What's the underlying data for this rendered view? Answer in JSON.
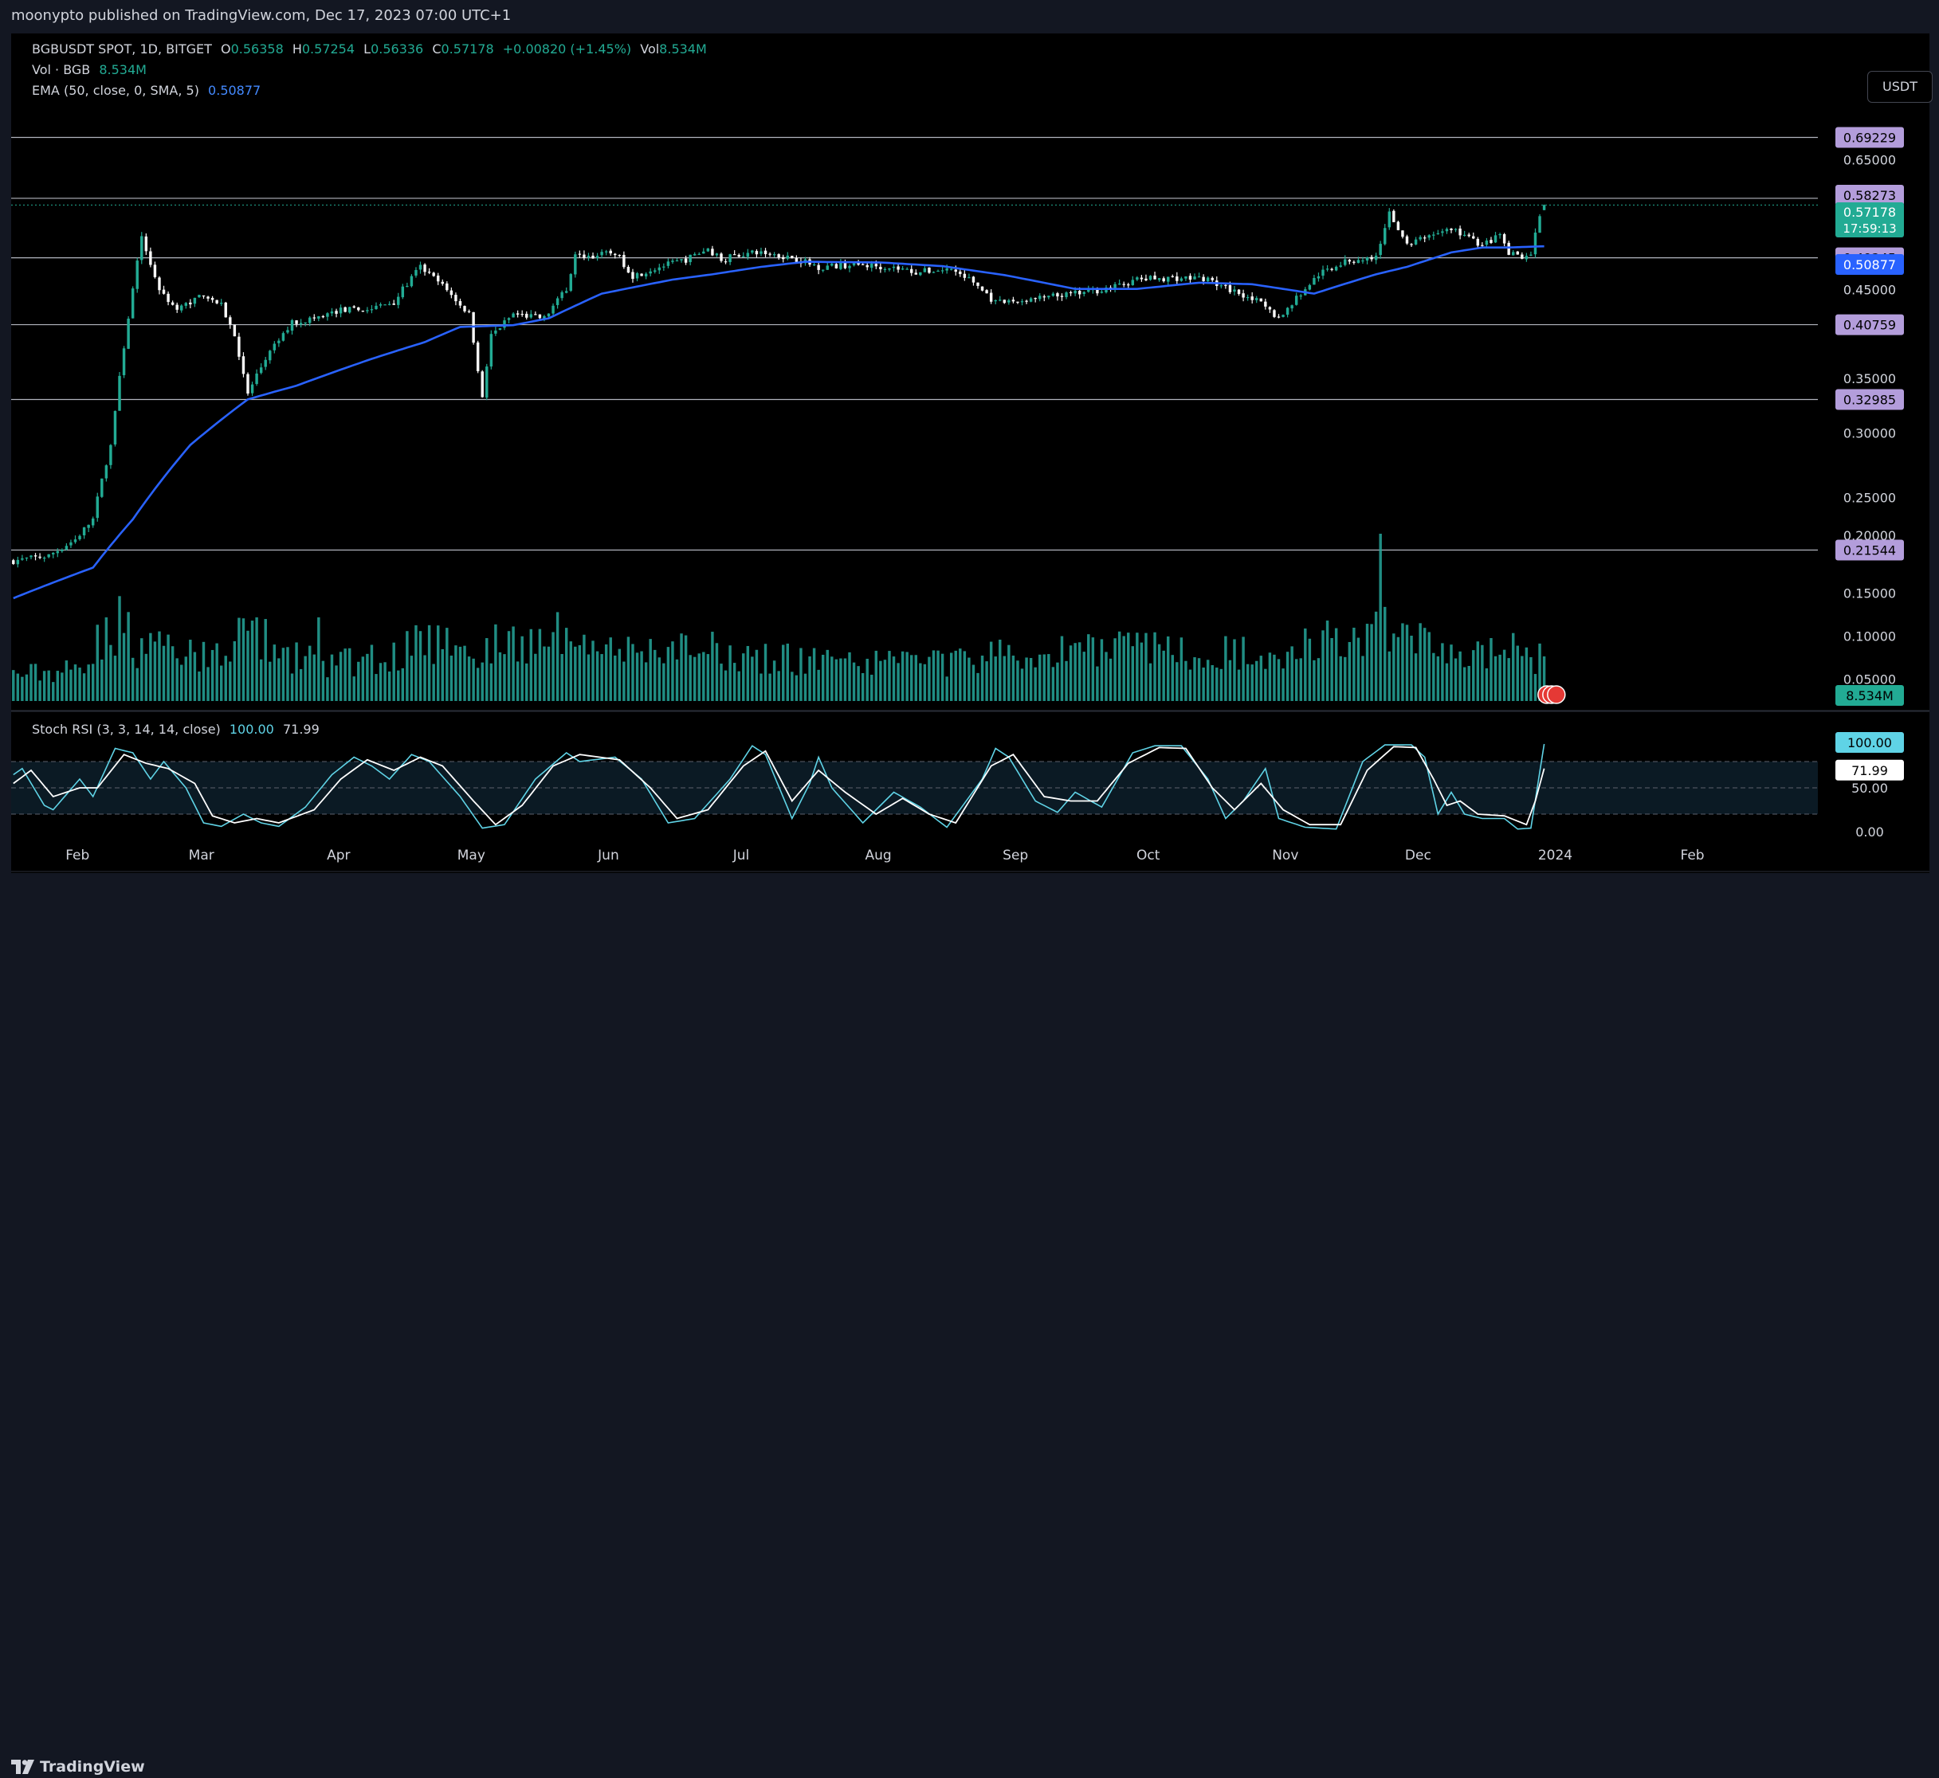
{
  "publish_line": "moonypto published on TradingView.com, Dec 17, 2023 07:00 UTC+1",
  "brand": "TradingView",
  "currency_button": "USDT",
  "legend": {
    "symbol": "BGBUSDT SPOT, 1D, BITGET",
    "open_label": "O",
    "open": "0.56358",
    "high_label": "H",
    "high": "0.57254",
    "low_label": "L",
    "low": "0.56336",
    "close_label": "C",
    "close": "0.57178",
    "change": "+0.00820 (+1.45%)",
    "vol_label": "Vol",
    "vol": "8.534M",
    "vol_row_label": "Vol · BGB",
    "vol_row_value": "8.534M",
    "ema_label": "EMA (50, close, 0, SMA, 5)",
    "ema_value": "0.50877",
    "stoch_label": "Stoch RSI (3, 3, 14, 14, close)",
    "stoch_k": "100.00",
    "stoch_d": "71.99"
  },
  "colors": {
    "up": "#22ab94",
    "down": "#f7f7f7",
    "ema": "#2962ff",
    "level": "#b2b5be",
    "level_badge": "#b39ddb",
    "stoch_k": "#5fd3e6",
    "stoch_d": "#ffffff",
    "volume": "#26a69a"
  },
  "chart_data": {
    "type": "candlestick",
    "x_range": [
      "2023-01-17",
      "2024-02-29"
    ],
    "x_ticks": [
      {
        "label": "Feb",
        "date": "2023-02-01"
      },
      {
        "label": "Mar",
        "date": "2023-03-01"
      },
      {
        "label": "Apr",
        "date": "2023-04-01"
      },
      {
        "label": "May",
        "date": "2023-05-01"
      },
      {
        "label": "Jun",
        "date": "2023-06-01"
      },
      {
        "label": "Jul",
        "date": "2023-07-01"
      },
      {
        "label": "Aug",
        "date": "2023-08-01"
      },
      {
        "label": "Sep",
        "date": "2023-09-01"
      },
      {
        "label": "Oct",
        "date": "2023-10-01"
      },
      {
        "label": "Nov",
        "date": "2023-11-01"
      },
      {
        "label": "Dec",
        "date": "2023-12-01"
      },
      {
        "label": "2024",
        "date": "2024-01-01"
      },
      {
        "label": "Feb",
        "date": "2024-02-01"
      }
    ],
    "y_ticks": [
      "0.65000",
      "0.45000",
      "0.35000",
      "0.30000",
      "0.25000",
      "0.20000",
      "0.15000",
      "0.10000",
      "0.05000"
    ],
    "y_range": [
      0.028,
      0.7
    ],
    "horizontal_levels": [
      "0.69229",
      "0.58273",
      "0.49245",
      "0.40759",
      "0.32985",
      "0.21544"
    ],
    "last_price": "0.57178",
    "countdown": "17:59:13",
    "ema_last": "0.50877",
    "volume_last": "8.534M",
    "price_anchors": [
      [
        "2023-01-17",
        0.209
      ],
      [
        "2023-01-25",
        0.212
      ],
      [
        "2023-01-31",
        0.222
      ],
      [
        "2023-02-04",
        0.235
      ],
      [
        "2023-02-08",
        0.29
      ],
      [
        "2023-02-10",
        0.35
      ],
      [
        "2023-02-13",
        0.45
      ],
      [
        "2023-02-15",
        0.52
      ],
      [
        "2023-02-19",
        0.45
      ],
      [
        "2023-02-23",
        0.425
      ],
      [
        "2023-03-01",
        0.445
      ],
      [
        "2023-03-05",
        0.43
      ],
      [
        "2023-03-08",
        0.395
      ],
      [
        "2023-03-11",
        0.335
      ],
      [
        "2023-03-15",
        0.37
      ],
      [
        "2023-03-21",
        0.41
      ],
      [
        "2023-03-26",
        0.415
      ],
      [
        "2023-04-01",
        0.425
      ],
      [
        "2023-04-07",
        0.425
      ],
      [
        "2023-04-13",
        0.435
      ],
      [
        "2023-04-19",
        0.48
      ],
      [
        "2023-04-24",
        0.455
      ],
      [
        "2023-04-30",
        0.42
      ],
      [
        "2023-05-03",
        0.33
      ],
      [
        "2023-05-05",
        0.395
      ],
      [
        "2023-05-10",
        0.42
      ],
      [
        "2023-05-17",
        0.415
      ],
      [
        "2023-05-22",
        0.45
      ],
      [
        "2023-05-24",
        0.495
      ],
      [
        "2023-05-28",
        0.495
      ],
      [
        "2023-06-02",
        0.5
      ],
      [
        "2023-06-06",
        0.468
      ],
      [
        "2023-06-12",
        0.48
      ],
      [
        "2023-06-18",
        0.49
      ],
      [
        "2023-06-23",
        0.505
      ],
      [
        "2023-06-26",
        0.49
      ],
      [
        "2023-06-30",
        0.497
      ],
      [
        "2023-07-05",
        0.5
      ],
      [
        "2023-07-12",
        0.493
      ],
      [
        "2023-07-18",
        0.48
      ],
      [
        "2023-07-26",
        0.483
      ],
      [
        "2023-08-03",
        0.48
      ],
      [
        "2023-08-09",
        0.473
      ],
      [
        "2023-08-17",
        0.477
      ],
      [
        "2023-08-22",
        0.46
      ],
      [
        "2023-08-27",
        0.433
      ],
      [
        "2023-09-03",
        0.437
      ],
      [
        "2023-09-10",
        0.442
      ],
      [
        "2023-09-17",
        0.447
      ],
      [
        "2023-09-24",
        0.455
      ],
      [
        "2023-09-28",
        0.463
      ],
      [
        "2023-10-03",
        0.465
      ],
      [
        "2023-10-08",
        0.465
      ],
      [
        "2023-10-13",
        0.465
      ],
      [
        "2023-10-18",
        0.452
      ],
      [
        "2023-10-24",
        0.44
      ],
      [
        "2023-10-30",
        0.415
      ],
      [
        "2023-11-04",
        0.445
      ],
      [
        "2023-11-08",
        0.47
      ],
      [
        "2023-11-13",
        0.485
      ],
      [
        "2023-11-17",
        0.49
      ],
      [
        "2023-11-21",
        0.493
      ],
      [
        "2023-11-24",
        0.56
      ],
      [
        "2023-11-28",
        0.51
      ],
      [
        "2023-12-03",
        0.525
      ],
      [
        "2023-12-08",
        0.535
      ],
      [
        "2023-12-15",
        0.51
      ],
      [
        "2023-12-19",
        0.525
      ],
      [
        "2023-12-21",
        0.497
      ],
      [
        "2023-12-25",
        0.495
      ],
      [
        "2023-12-26",
        0.5
      ],
      [
        "2023-12-28",
        0.553
      ],
      [
        "2023-12-29",
        0.5718
      ]
    ],
    "ema_anchors": [
      [
        "2023-01-17",
        0.188
      ],
      [
        "2023-02-04",
        0.205
      ],
      [
        "2023-02-13",
        0.235
      ],
      [
        "2023-02-26",
        0.29
      ],
      [
        "2023-03-11",
        0.33
      ],
      [
        "2023-03-22",
        0.343
      ],
      [
        "2023-04-08",
        0.37
      ],
      [
        "2023-04-20",
        0.388
      ],
      [
        "2023-04-28",
        0.405
      ],
      [
        "2023-05-10",
        0.407
      ],
      [
        "2023-05-18",
        0.415
      ],
      [
        "2023-05-30",
        0.445
      ],
      [
        "2023-06-15",
        0.463
      ],
      [
        "2023-06-24",
        0.47
      ],
      [
        "2023-07-05",
        0.48
      ],
      [
        "2023-07-15",
        0.487
      ],
      [
        "2023-08-01",
        0.486
      ],
      [
        "2023-08-15",
        0.481
      ],
      [
        "2023-08-29",
        0.469
      ],
      [
        "2023-09-14",
        0.451
      ],
      [
        "2023-09-28",
        0.451
      ],
      [
        "2023-10-12",
        0.459
      ],
      [
        "2023-10-24",
        0.457
      ],
      [
        "2023-11-07",
        0.445
      ],
      [
        "2023-11-21",
        0.47
      ],
      [
        "2023-11-28",
        0.48
      ],
      [
        "2023-12-08",
        0.5
      ],
      [
        "2023-12-15",
        0.507
      ],
      [
        "2023-12-21",
        0.507
      ],
      [
        "2023-12-29",
        0.5088
      ]
    ],
    "volume_max_M": 32,
    "volume_anchors": [
      [
        "2023-01-17",
        5
      ],
      [
        "2023-01-31",
        6
      ],
      [
        "2023-02-06",
        12
      ],
      [
        "2023-02-11",
        16
      ],
      [
        "2023-02-14",
        10
      ],
      [
        "2023-02-25",
        9
      ],
      [
        "2023-03-03",
        8
      ],
      [
        "2023-03-10",
        14
      ],
      [
        "2023-03-20",
        9
      ],
      [
        "2023-03-28",
        7
      ],
      [
        "2023-04-10",
        8
      ],
      [
        "2023-04-20",
        12
      ],
      [
        "2023-05-01",
        9
      ],
      [
        "2023-05-10",
        12
      ],
      [
        "2023-05-18",
        11
      ],
      [
        "2023-05-24",
        17
      ],
      [
        "2023-06-02",
        10
      ],
      [
        "2023-06-12",
        9
      ],
      [
        "2023-06-20",
        10
      ],
      [
        "2023-07-01",
        9
      ],
      [
        "2023-07-15",
        8
      ],
      [
        "2023-08-01",
        7
      ],
      [
        "2023-08-20",
        8
      ],
      [
        "2023-09-05",
        9
      ],
      [
        "2023-09-20",
        11
      ],
      [
        "2023-10-05",
        10
      ],
      [
        "2023-10-20",
        9
      ],
      [
        "2023-11-01",
        10
      ],
      [
        "2023-11-10",
        12
      ],
      [
        "2023-11-18",
        11
      ],
      [
        "2023-11-23",
        15
      ],
      [
        "2023-11-26",
        12
      ],
      [
        "2023-12-05",
        10
      ],
      [
        "2023-12-15",
        9
      ],
      [
        "2023-12-25",
        8
      ],
      [
        "2023-12-29",
        8.534
      ]
    ],
    "volume_spikes": [
      [
        "2023-02-07",
        16
      ],
      [
        "2023-02-17",
        13
      ],
      [
        "2023-03-13",
        16
      ],
      [
        "2023-03-27",
        16
      ],
      [
        "2023-04-25",
        14
      ],
      [
        "2023-05-20",
        17
      ],
      [
        "2023-05-22",
        14
      ],
      [
        "2023-11-22",
        32
      ],
      [
        "2023-11-23",
        18
      ],
      [
        "2023-12-22",
        13
      ]
    ],
    "stoch_rsi": {
      "bands": [
        "80",
        "50",
        "20"
      ],
      "y_ticks": [
        "50.00",
        "0.00"
      ],
      "k_last": "100.00",
      "d_last": "71.99",
      "k_anchors": [
        [
          "2023-01-17",
          65
        ],
        [
          "2023-01-19",
          72
        ],
        [
          "2023-01-24",
          30
        ],
        [
          "2023-01-26",
          25
        ],
        [
          "2023-02-01",
          60
        ],
        [
          "2023-02-04",
          40
        ],
        [
          "2023-02-09",
          95
        ],
        [
          "2023-02-13",
          90
        ],
        [
          "2023-02-17",
          60
        ],
        [
          "2023-02-20",
          80
        ],
        [
          "2023-02-25",
          50
        ],
        [
          "2023-03-01",
          10
        ],
        [
          "2023-03-05",
          6
        ],
        [
          "2023-03-10",
          20
        ],
        [
          "2023-03-14",
          10
        ],
        [
          "2023-03-18",
          6
        ],
        [
          "2023-03-24",
          28
        ],
        [
          "2023-03-30",
          65
        ],
        [
          "2023-04-04",
          85
        ],
        [
          "2023-04-08",
          75
        ],
        [
          "2023-04-12",
          60
        ],
        [
          "2023-04-17",
          88
        ],
        [
          "2023-04-21",
          80
        ],
        [
          "2023-04-28",
          40
        ],
        [
          "2023-05-03",
          4
        ],
        [
          "2023-05-08",
          8
        ],
        [
          "2023-05-15",
          60
        ],
        [
          "2023-05-22",
          90
        ],
        [
          "2023-05-25",
          80
        ],
        [
          "2023-06-02",
          85
        ],
        [
          "2023-06-08",
          60
        ],
        [
          "2023-06-14",
          10
        ],
        [
          "2023-06-20",
          15
        ],
        [
          "2023-06-28",
          60
        ],
        [
          "2023-07-03",
          98
        ],
        [
          "2023-07-06",
          88
        ],
        [
          "2023-07-12",
          15
        ],
        [
          "2023-07-16",
          55
        ],
        [
          "2023-07-18",
          85
        ],
        [
          "2023-07-21",
          50
        ],
        [
          "2023-07-28",
          10
        ],
        [
          "2023-08-04",
          45
        ],
        [
          "2023-08-10",
          28
        ],
        [
          "2023-08-16",
          5
        ],
        [
          "2023-08-24",
          60
        ],
        [
          "2023-08-27",
          95
        ],
        [
          "2023-08-30",
          85
        ],
        [
          "2023-09-05",
          35
        ],
        [
          "2023-09-10",
          22
        ],
        [
          "2023-09-14",
          45
        ],
        [
          "2023-09-20",
          28
        ],
        [
          "2023-09-27",
          90
        ],
        [
          "2023-10-02",
          98
        ],
        [
          "2023-10-08",
          98
        ],
        [
          "2023-10-14",
          60
        ],
        [
          "2023-10-18",
          15
        ],
        [
          "2023-10-22",
          35
        ],
        [
          "2023-10-27",
          72
        ],
        [
          "2023-10-30",
          15
        ],
        [
          "2023-11-05",
          5
        ],
        [
          "2023-11-12",
          3
        ],
        [
          "2023-11-18",
          80
        ],
        [
          "2023-11-23",
          99
        ],
        [
          "2023-11-29",
          99
        ],
        [
          "2023-12-02",
          85
        ],
        [
          "2023-12-05",
          20
        ],
        [
          "2023-12-08",
          45
        ],
        [
          "2023-12-11",
          20
        ],
        [
          "2023-12-15",
          15
        ],
        [
          "2023-12-20",
          15
        ],
        [
          "2023-12-23",
          3
        ],
        [
          "2023-12-26",
          4
        ],
        [
          "2023-12-29",
          100
        ]
      ],
      "d_anchors": [
        [
          "2023-01-17",
          55
        ],
        [
          "2023-01-21",
          70
        ],
        [
          "2023-01-26",
          40
        ],
        [
          "2023-02-01",
          50
        ],
        [
          "2023-02-05",
          50
        ],
        [
          "2023-02-11",
          88
        ],
        [
          "2023-02-16",
          78
        ],
        [
          "2023-02-21",
          72
        ],
        [
          "2023-02-27",
          55
        ],
        [
          "2023-03-03",
          18
        ],
        [
          "2023-03-08",
          10
        ],
        [
          "2023-03-13",
          15
        ],
        [
          "2023-03-18",
          10
        ],
        [
          "2023-03-26",
          25
        ],
        [
          "2023-04-01",
          60
        ],
        [
          "2023-04-07",
          82
        ],
        [
          "2023-04-13",
          70
        ],
        [
          "2023-04-19",
          85
        ],
        [
          "2023-04-24",
          75
        ],
        [
          "2023-05-01",
          35
        ],
        [
          "2023-05-06",
          8
        ],
        [
          "2023-05-12",
          30
        ],
        [
          "2023-05-19",
          75
        ],
        [
          "2023-05-25",
          88
        ],
        [
          "2023-06-03",
          82
        ],
        [
          "2023-06-10",
          50
        ],
        [
          "2023-06-16",
          15
        ],
        [
          "2023-06-23",
          25
        ],
        [
          "2023-07-01",
          75
        ],
        [
          "2023-07-06",
          92
        ],
        [
          "2023-07-12",
          35
        ],
        [
          "2023-07-18",
          70
        ],
        [
          "2023-07-24",
          45
        ],
        [
          "2023-07-31",
          20
        ],
        [
          "2023-08-06",
          38
        ],
        [
          "2023-08-12",
          20
        ],
        [
          "2023-08-18",
          10
        ],
        [
          "2023-08-26",
          75
        ],
        [
          "2023-08-31",
          88
        ],
        [
          "2023-09-07",
          40
        ],
        [
          "2023-09-13",
          35
        ],
        [
          "2023-09-19",
          35
        ],
        [
          "2023-09-26",
          78
        ],
        [
          "2023-10-03",
          96
        ],
        [
          "2023-10-09",
          95
        ],
        [
          "2023-10-15",
          50
        ],
        [
          "2023-10-20",
          25
        ],
        [
          "2023-10-26",
          55
        ],
        [
          "2023-10-31",
          25
        ],
        [
          "2023-11-06",
          8
        ],
        [
          "2023-11-13",
          8
        ],
        [
          "2023-11-19",
          70
        ],
        [
          "2023-11-25",
          97
        ],
        [
          "2023-11-30",
          96
        ],
        [
          "2023-12-04",
          60
        ],
        [
          "2023-12-07",
          30
        ],
        [
          "2023-12-10",
          35
        ],
        [
          "2023-12-14",
          20
        ],
        [
          "2023-12-20",
          18
        ],
        [
          "2023-12-25",
          8
        ],
        [
          "2023-12-27",
          35
        ],
        [
          "2023-12-29",
          71.99
        ]
      ]
    }
  }
}
